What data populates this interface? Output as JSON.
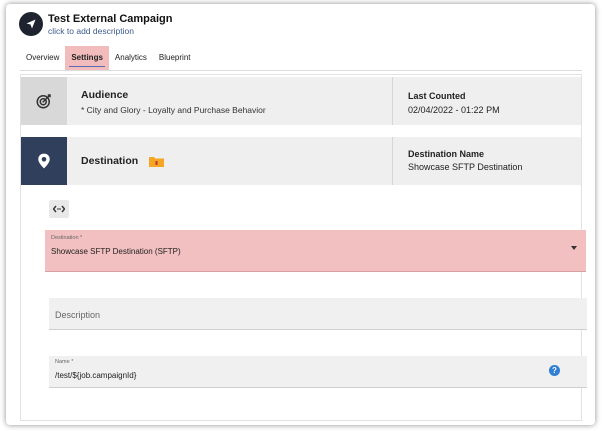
{
  "campaign": {
    "title": "Test External Campaign",
    "description_link": "click to add description"
  },
  "tabs": [
    {
      "label": "Overview",
      "active": false
    },
    {
      "label": "Settings",
      "active": true
    },
    {
      "label": "Analytics",
      "active": false
    },
    {
      "label": "Blueprint",
      "active": false
    }
  ],
  "audience": {
    "title": "Audience",
    "subtitle": "* City and Glory - Loyalty and Purchase Behavior",
    "right_title": "Last Counted",
    "right_value": "02/04/2022 - 01:22 PM",
    "icon": "target-icon"
  },
  "destination": {
    "title": "Destination",
    "right_title": "Destination Name",
    "right_value": "Showcase SFTP Destination",
    "icon": "location-pin-icon",
    "badge_icon": "folder-icon"
  },
  "form": {
    "destination_field": {
      "label": "Destination *",
      "value": "Showcase SFTP Destination (SFTP)"
    },
    "description_field": {
      "placeholder": "Description"
    },
    "name_field": {
      "label": "Name *",
      "value": "/test/${job.campaignId}"
    }
  },
  "colors": {
    "highlight": "#f2bcbc",
    "dark_navy": "#2f3f5c",
    "tab_underline": "#5b6bb5",
    "help_blue": "#2f7fd4"
  }
}
